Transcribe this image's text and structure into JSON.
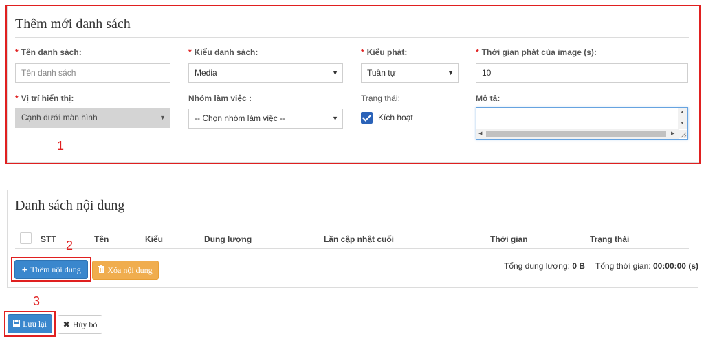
{
  "form": {
    "title": "Thêm mới danh sách",
    "required_mark": "*",
    "name": {
      "label": "Tên danh sách:",
      "placeholder": "Tên danh sách",
      "value": ""
    },
    "list_type": {
      "label": "Kiểu danh sách:",
      "value": "Media"
    },
    "play_mode": {
      "label": "Kiểu phát:",
      "value": "Tuần tự"
    },
    "image_duration": {
      "label": "Thời gian phát của image (s):",
      "value": "10"
    },
    "position": {
      "label": "Vị trí hiển thị:",
      "value": "Cạnh dưới màn hình"
    },
    "workgroup": {
      "label": "Nhóm làm việc :",
      "value": "-- Chọn nhóm làm việc --"
    },
    "status": {
      "label": "Trạng thái:",
      "checkbox_label": "Kích hoạt",
      "checked": true
    },
    "description": {
      "label": "Mô tả:",
      "value": ""
    }
  },
  "content_list": {
    "title": "Danh sách nội dung",
    "columns": [
      "STT",
      "Tên",
      "Kiểu",
      "Dung lượng",
      "Lần cập nhật cuối",
      "Thời gian",
      "Trạng thái"
    ],
    "rows": [],
    "add_button": "Thêm nội dung",
    "delete_button": "Xóa nội dung",
    "total_size_label": "Tổng dung lượng:",
    "total_size_value": "0 B",
    "total_time_label": "Tổng thời gian:",
    "total_time_value": "00:00:00",
    "total_time_unit": "(s)"
  },
  "actions": {
    "save_button": "Lưu lại",
    "cancel_button": "Hủy bỏ"
  },
  "annotations": [
    "1",
    "2",
    "3"
  ],
  "colors": {
    "annotation": "#e02020",
    "primary": "#3a87cd",
    "warning": "#f0ad4e",
    "checkbox": "#2a62b8"
  },
  "icons": {
    "caret": "caret-down-icon",
    "add": "plus-icon",
    "delete": "trash-icon",
    "save": "floppy-icon",
    "cancel": "close-icon"
  }
}
